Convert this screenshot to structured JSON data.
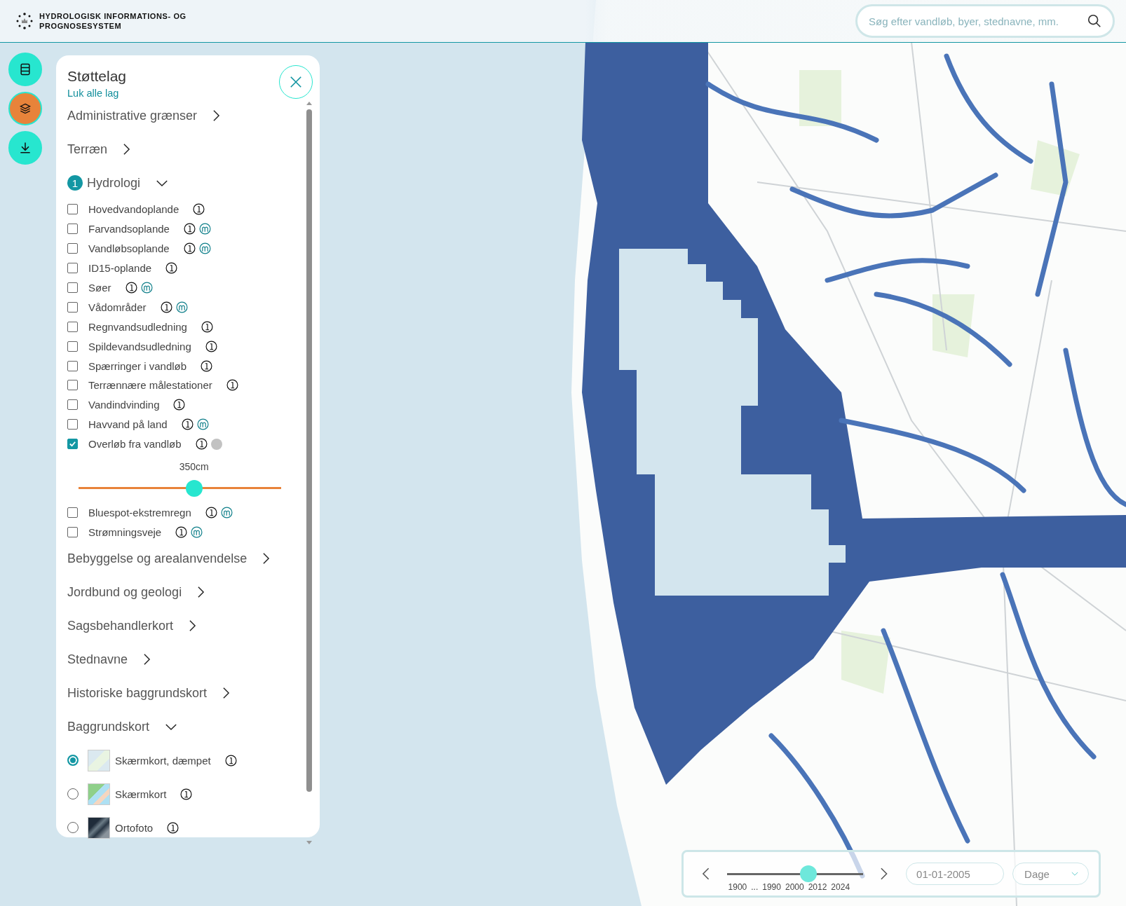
{
  "header": {
    "title_lines": [
      "HYDROLOGISK INFORMATIONS- OG",
      "PROGNOSESYSTEM"
    ]
  },
  "search": {
    "placeholder": "Søg efter vandløb, byer, stednavne, mm."
  },
  "side_buttons": [
    {
      "kind": "database",
      "selected": false
    },
    {
      "kind": "layers",
      "selected": true
    },
    {
      "kind": "download",
      "selected": false
    }
  ],
  "panel": {
    "title": "Støttelag",
    "close_all": "Luk alle lag",
    "categories": [
      {
        "label": "Administrative grænser",
        "expanded": false
      },
      {
        "label": "Terræn",
        "expanded": false
      },
      {
        "label": "Hydrologi",
        "expanded": true,
        "badge": "1",
        "items": [
          {
            "kind": "checkbox",
            "label": "Hovedvandoplande",
            "checked": false,
            "icons": [
              {
                "kind": "info"
              }
            ]
          },
          {
            "kind": "checkbox",
            "label": "Farvandsoplande",
            "checked": false,
            "icons": [
              {
                "kind": "info"
              },
              {
                "kind": "m"
              }
            ]
          },
          {
            "kind": "checkbox",
            "label": "Vandløbsoplande",
            "checked": false,
            "icons": [
              {
                "kind": "info"
              },
              {
                "kind": "m"
              }
            ]
          },
          {
            "kind": "checkbox",
            "label": "ID15-oplande",
            "checked": false,
            "icons": [
              {
                "kind": "info"
              }
            ]
          },
          {
            "kind": "checkbox",
            "label": "Søer",
            "checked": false,
            "icons": [
              {
                "kind": "info"
              },
              {
                "kind": "m"
              }
            ]
          },
          {
            "kind": "checkbox",
            "label": "Vådområder",
            "checked": false,
            "icons": [
              {
                "kind": "info"
              },
              {
                "kind": "m"
              }
            ]
          },
          {
            "kind": "checkbox",
            "label": "Regnvandsudledning",
            "checked": false,
            "icons": [
              {
                "kind": "info"
              }
            ]
          },
          {
            "kind": "checkbox",
            "label": "Spildevandsudledning",
            "checked": false,
            "icons": [
              {
                "kind": "info"
              }
            ]
          },
          {
            "kind": "checkbox",
            "label": "Spærringer i vandløb",
            "checked": false,
            "icons": [
              {
                "kind": "info"
              }
            ]
          },
          {
            "kind": "checkbox",
            "label": "Terrænnære målestationer",
            "checked": false,
            "icons": [
              {
                "kind": "info"
              }
            ]
          },
          {
            "kind": "checkbox",
            "label": "Vandindvinding",
            "checked": false,
            "icons": [
              {
                "kind": "info"
              }
            ]
          },
          {
            "kind": "checkbox",
            "label": "Havvand på land",
            "checked": false,
            "icons": [
              {
                "kind": "info"
              },
              {
                "kind": "m"
              }
            ]
          },
          {
            "kind": "checkbox",
            "label": "Overløb fra vandløb",
            "checked": true,
            "icons": [
              {
                "kind": "info"
              },
              {
                "kind": "dot"
              }
            ]
          },
          {
            "kind": "slider",
            "reading": "350cm",
            "level": 0.57
          },
          {
            "kind": "checkbox",
            "label": "Bluespot-ekstremregn",
            "checked": false,
            "icons": [
              {
                "kind": "info"
              },
              {
                "kind": "m"
              }
            ]
          },
          {
            "kind": "checkbox",
            "label": "Strømningsveje",
            "checked": false,
            "icons": [
              {
                "kind": "info"
              },
              {
                "kind": "m"
              }
            ]
          }
        ]
      },
      {
        "label": "Bebyggelse og arealanvendelse",
        "expanded": false
      },
      {
        "label": "Jordbund og geologi",
        "expanded": false
      },
      {
        "label": "Sagsbehandlerkort",
        "expanded": false
      },
      {
        "label": "Stednavne",
        "expanded": false
      },
      {
        "label": "Historiske baggrundskort",
        "expanded": false
      },
      {
        "label": "Baggrundskort",
        "expanded": true,
        "items": [
          {
            "kind": "radio",
            "label": "Skærmkort, dæmpet",
            "selected": true,
            "thumb": {
              "kind": "muted"
            }
          },
          {
            "kind": "radio",
            "label": "Skærmkort",
            "selected": false,
            "thumb": {
              "kind": "map"
            }
          },
          {
            "kind": "radio",
            "label": "Ortofoto",
            "selected": false,
            "thumb": {
              "kind": "photo"
            }
          }
        ]
      }
    ]
  },
  "timeline": {
    "level": 0.6,
    "ticks": [
      "1900",
      "...",
      "1990",
      "2000",
      "2012",
      "2024"
    ],
    "date": "01-01-2005",
    "interval": "Dage"
  }
}
